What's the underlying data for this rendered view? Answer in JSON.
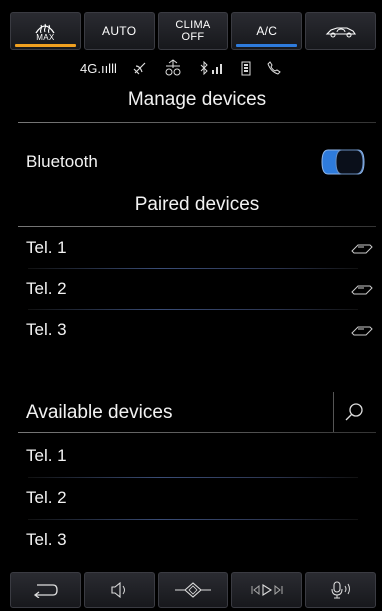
{
  "climate": {
    "buttons": [
      {
        "label": "MAX",
        "icon": "defrost-icon",
        "accent": "#f0a020"
      },
      {
        "label": "AUTO",
        "accent": ""
      },
      {
        "label_line1": "CLIMA",
        "label_line2": "OFF",
        "accent": ""
      },
      {
        "label": "A/C",
        "accent": "#2e7bdc"
      },
      {
        "icon": "car-recirculation-icon",
        "accent": ""
      }
    ]
  },
  "status": {
    "network": "4G.ıılll",
    "icons": [
      "satellite-icon",
      "usb-icon",
      "bluetooth-signal-icon",
      "battery-icon",
      "phone-icon"
    ]
  },
  "header": {
    "title": "Manage devices"
  },
  "bluetooth": {
    "label": "Bluetooth",
    "enabled": true,
    "toggle_color": "#2e7bdc"
  },
  "paired": {
    "title": "Paired devices",
    "devices": [
      {
        "name": "Tel. 1"
      },
      {
        "name": "Tel. 2"
      },
      {
        "name": "Tel. 3"
      }
    ]
  },
  "available": {
    "title": "Available devices",
    "devices": [
      {
        "name": "Tel. 1"
      },
      {
        "name": "Tel. 2"
      },
      {
        "name": "Tel. 3"
      }
    ]
  },
  "toolbar": {
    "icons": [
      "back-icon",
      "volume-icon",
      "navigation-icon",
      "media-icon",
      "voice-icon"
    ]
  }
}
